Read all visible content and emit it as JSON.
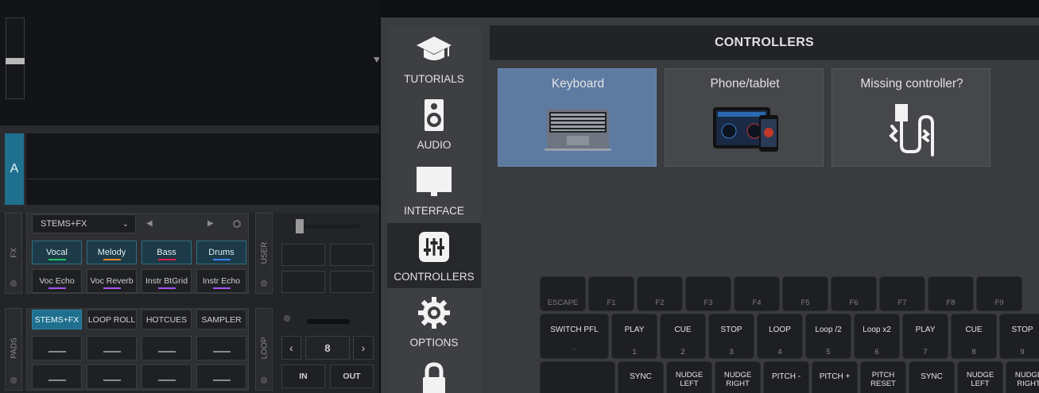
{
  "deck": {
    "letter": "A",
    "fx_panel": {
      "side_label": "FX",
      "stems_select": "STEMS+FX",
      "stem_buttons": [
        {
          "label": "Vocal",
          "color": "#22c55e"
        },
        {
          "label": "Melody",
          "color": "#e3862c"
        },
        {
          "label": "Bass",
          "color": "#e11d48"
        },
        {
          "label": "Drums",
          "color": "#3b82f6"
        }
      ],
      "fx_buttons": [
        {
          "label": "Voc Echo",
          "color": "#a855f7"
        },
        {
          "label": "Voc Reverb",
          "color": "#a855f7"
        },
        {
          "label": "Instr BtGrid",
          "color": "#a855f7"
        },
        {
          "label": "Instr Echo",
          "color": "#a855f7"
        }
      ]
    },
    "user_panel": {
      "side_label": "USER"
    },
    "pads_panel": {
      "side_label": "PADS",
      "tabs": [
        "STEMS+FX",
        "LOOP ROLL",
        "HOTCUES",
        "SAMPLER"
      ],
      "active_tab": "STEMS+FX"
    },
    "loop_panel": {
      "side_label": "LOOP",
      "size": "8",
      "in_label": "IN",
      "out_label": "OUT"
    }
  },
  "settings": {
    "nav": [
      {
        "label": "TUTORIALS",
        "icon": "graduation-cap-icon"
      },
      {
        "label": "AUDIO",
        "icon": "speaker-icon"
      },
      {
        "label": "INTERFACE",
        "icon": "monitor-icon"
      },
      {
        "label": "CONTROLLERS",
        "icon": "sliders-icon",
        "active": true
      },
      {
        "label": "OPTIONS",
        "icon": "gear-icon"
      }
    ],
    "title": "CONTROLLERS",
    "cards": [
      {
        "label": "Keyboard",
        "selected": true
      },
      {
        "label": "Phone/tablet"
      },
      {
        "label": "Missing controller?"
      }
    ],
    "keyboard": {
      "row1": [
        "ESCAPE",
        "F1",
        "F2",
        "F3",
        "F4",
        "F5",
        "F6",
        "F7",
        "F8",
        "F9"
      ],
      "row2": [
        {
          "label": "SWITCH PFL",
          "num": "`"
        },
        {
          "label": "PLAY",
          "num": "1"
        },
        {
          "label": "CUE",
          "num": "2"
        },
        {
          "label": "STOP",
          "num": "3"
        },
        {
          "label": "LOOP",
          "num": "4"
        },
        {
          "label": "Loop /2",
          "num": "5"
        },
        {
          "label": "Loop x2",
          "num": "6"
        },
        {
          "label": "PLAY",
          "num": "7"
        },
        {
          "label": "CUE",
          "num": "8"
        },
        {
          "label": "STOP",
          "num": "9"
        }
      ],
      "row3": [
        "SYNC",
        "NUDGE LEFT",
        "NUDGE RIGHT",
        "PITCH -",
        "PITCH +",
        "PITCH RESET",
        "SYNC",
        "NUDGE LEFT",
        "NUDGE RIGHT"
      ]
    },
    "colors": {
      "accent": "#1f6f8e",
      "selected_card": "#5d7aa1"
    }
  }
}
